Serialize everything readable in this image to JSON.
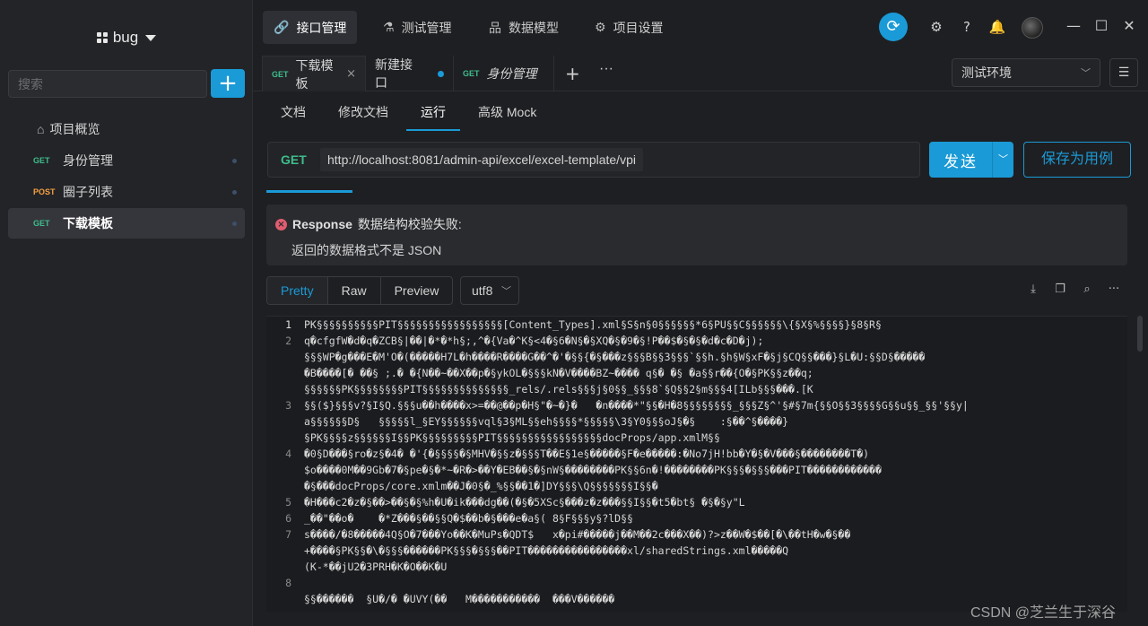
{
  "sidebar": {
    "project_name": "bug",
    "search_placeholder": "搜索",
    "add_label": "+",
    "overview_label": "项目概览",
    "items": [
      {
        "method": "GET",
        "label": "身份管理"
      },
      {
        "method": "POST",
        "label": "圈子列表"
      },
      {
        "method": "GET",
        "label": "下载模板"
      }
    ]
  },
  "topbar": {
    "tabs": [
      {
        "icon": "🔗",
        "label": "接口管理"
      },
      {
        "icon": "⚗",
        "label": "测试管理"
      },
      {
        "icon": "品",
        "label": "数据模型"
      },
      {
        "icon": "⚙",
        "label": "项目设置"
      }
    ]
  },
  "request_tabs": [
    {
      "method": "GET",
      "label": "下载模板"
    },
    {
      "label": "新建接口"
    },
    {
      "method": "GET",
      "label": "身份管理"
    }
  ],
  "environment": {
    "selected": "测试环境"
  },
  "subtabs": [
    "文档",
    "修改文档",
    "运行",
    "高级 Mock"
  ],
  "request": {
    "method": "GET",
    "url": "http://localhost:8081/admin-api/excel/excel-template/vpi",
    "send_label": "发送",
    "save_case_label": "保存为用例"
  },
  "error": {
    "prefix": "Response",
    "title": "数据结构校验失败:",
    "message": "返回的数据格式不是 JSON"
  },
  "response": {
    "views": [
      "Pretty",
      "Raw",
      "Preview"
    ],
    "active_view": "Pretty",
    "encoding": "utf8",
    "lines": [
      {
        "n": "1",
        "t": "PK§§§§§§§§§§PIT§§§§§§§§§§§§§§§§§[Content_Types].xml§S§n§0§§§§§§*6§PU§§C§§§§§§\\{§X§%§§§§}§8§R§"
      },
      {
        "n": "2",
        "t": "q�cfgfW�d�q�ZCB§|��|�*�*h§;,^�{Va�^K§<4�§6�N§�§XQ�§�9�§!P��$�§�§�d�c�D�j);"
      },
      {
        "n": "",
        "t": "§§§WP�g���E�M'O�(�����H7L�h����R����G��^�'�§§{�§���z§§§B§§3§§§`§§h.§h§W§xF�§j§CQ§§���}§L�U:§§D§�����"
      },
      {
        "n": "",
        "t": "�B����[� ��§ ;.� �{N��~��X��p�§ykOL�§§§kN�V����BZ~���� q§� �§ �a§§r��{O�§PK§§z��q;"
      },
      {
        "n": "",
        "t": "§§§§§§PK§§§§§§§§PIT§§§§§§§§§§§§§§_rels/.rels§§§j§0§§_§§§8`§Q§§2§m§§§4[ILb§§§���.[K"
      },
      {
        "n": "3",
        "t": "§§($}§§§v?§I§Q.§§§u��h����x>=��@��p�H§\"�~�}�   �n����*\"§§�H�8§§§§§§§§_§§§Z§^'§#§7m{§§O§§3§§§§G§§u§§_§§'§§y|"
      },
      {
        "n": "",
        "t": "a§§§§§§D§   §§§§§l_§EY§§§§§§vql§3§ML§§eh§§§§*§§§§§\\3§Y0§§§oJ§�§    :§��^§����}"
      },
      {
        "n": "",
        "t": "§PK§§§§z§§§§§§I§§PK§§§§§§§§§PIT§§§§§§§§§§§§§§§§§docProps/app.xmlM§§"
      },
      {
        "n": "4",
        "t": "�0§D���§ro�z§�4� �'{�§§§§�§MHV�§§z�§§§T��E§1e§�����§F�e�����:�No7jH!bb�Y�§�V���§��������T�)"
      },
      {
        "n": "",
        "t": "$o����0M��9Gb�7�§pe�§�*~�R�>��Y�EB��§�§nW§��������PK§§6n�!��������PK§§§�§§§���PIT������������"
      },
      {
        "n": "",
        "t": "�§���docProps/core.xmlm��J�0§�_%§§��1�]DY§§§\\Q§§§§§§§I§§�"
      },
      {
        "n": "5",
        "t": "�H���c2�z�§��>��§�§%h�U�ik���dg��(�§�5XSc§���z�z���§§I§§�t5�bt§ �§�§y\"L"
      },
      {
        "n": "6",
        "t": "_��\"��o�    �*Z���§��§§Q�$��b�§���e�a§( 8§F§§§y§?lD§§"
      },
      {
        "n": "7",
        "t": "s����/�8�����4Q§O�7���Yo��K�MuPs�QDT$   x�pi#�����j��M��2c���X��)?>z��W�$��[�\\��tH�w�§��"
      },
      {
        "n": "",
        "t": "+����§PK§§�\\�§§§������PK§§§�§§§��PIT����������������xl/sharedStrings.xml�����Q"
      },
      {
        "n": "",
        "t": "(K-*��jU2�3PRH�K�O��K�U"
      },
      {
        "n": "8",
        "t": ""
      },
      {
        "n": "",
        "t": "§§������  §U�/� �UVY(��   M�����������  ���V������"
      }
    ]
  },
  "watermark": "CSDN @芝兰生于深谷"
}
